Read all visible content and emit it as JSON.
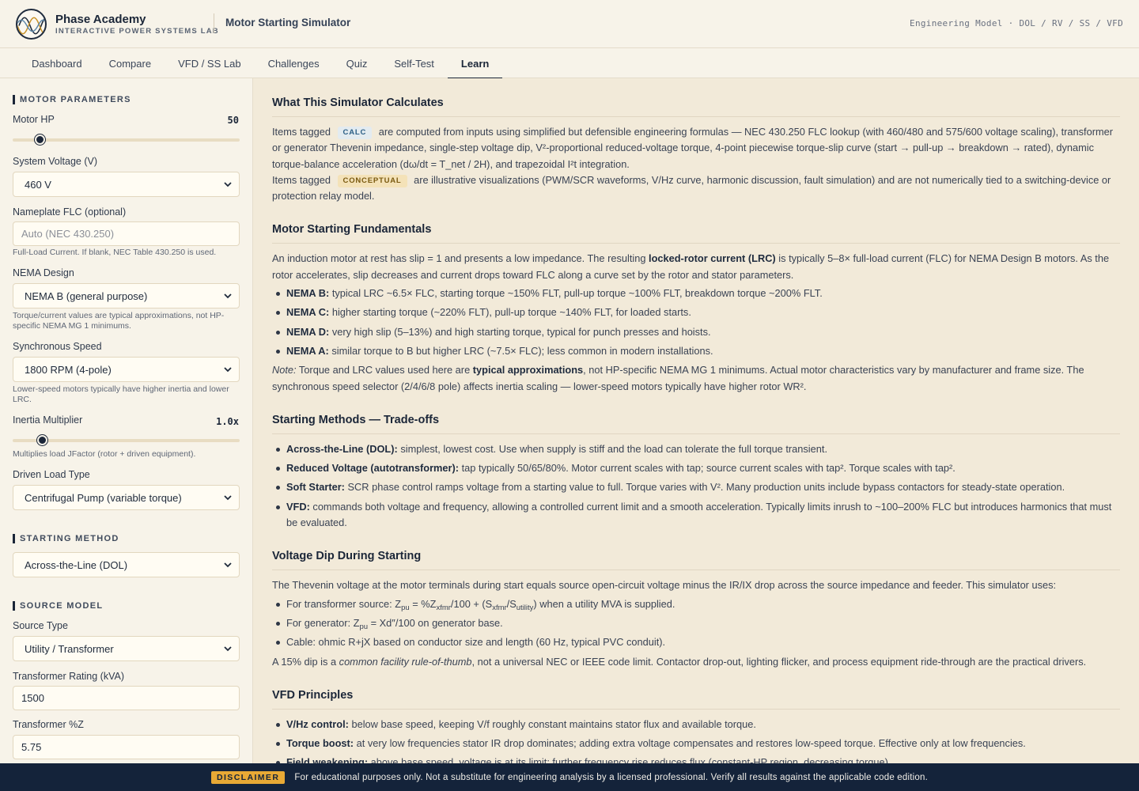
{
  "header": {
    "brand_name": "Phase Academy",
    "brand_sub": "INTERACTIVE POWER SYSTEMS LAB",
    "app_title": "Motor Starting Simulator",
    "meta": "Engineering Model · DOL / RV / SS / VFD"
  },
  "nav": {
    "tabs": [
      {
        "label": "Dashboard"
      },
      {
        "label": "Compare"
      },
      {
        "label": "VFD / SS Lab"
      },
      {
        "label": "Challenges"
      },
      {
        "label": "Quiz"
      },
      {
        "label": "Self-Test"
      },
      {
        "label": "Learn",
        "active": true
      }
    ]
  },
  "sidebar": {
    "motor_params": {
      "heading": "MOTOR PARAMETERS",
      "hp_label": "Motor HP",
      "hp_value": "50",
      "hp_slider_fraction": 0.12,
      "voltage_label": "System Voltage (V)",
      "voltage_value": "460 V",
      "flc_label": "Nameplate FLC (optional)",
      "flc_placeholder": "Auto (NEC 430.250)",
      "flc_hint": "Full-Load Current. If blank, NEC Table 430.250 is used.",
      "nema_label": "NEMA Design",
      "nema_value": "NEMA B (general purpose)",
      "nema_hint": "Torque/current values are typical approximations, not HP-specific NEMA MG 1 minimums.",
      "speed_label": "Synchronous Speed",
      "speed_value": "1800 RPM (4-pole)",
      "speed_hint": "Lower-speed motors typically have higher inertia and lower LRC.",
      "inertia_label": "Inertia Multiplier",
      "inertia_value": "1.0x",
      "inertia_slider_fraction": 0.13,
      "inertia_hint": "Multiplies load JFactor (rotor + driven equipment).",
      "load_label": "Driven Load Type",
      "load_value": "Centrifugal Pump (variable torque)"
    },
    "starting_method": {
      "heading": "STARTING METHOD",
      "value": "Across-the-Line (DOL)"
    },
    "source_model": {
      "heading": "SOURCE MODEL",
      "type_label": "Source Type",
      "type_value": "Utility / Transformer",
      "kva_label": "Transformer Rating (kVA)",
      "kva_value": "1500",
      "z_label": "Transformer %Z",
      "z_value": "5.75"
    }
  },
  "main": {
    "s1": {
      "title": "What This Simulator Calculates",
      "p1_a": "Items tagged",
      "tag_calc": "CALC",
      "p1_b": "are computed from inputs using simplified but defensible engineering formulas — NEC 430.250 FLC lookup (with 460/480 and 575/600 voltage scaling), transformer or generator Thevenin impedance, single-step voltage dip, V²-proportional reduced-voltage torque, 4-point piecewise torque-slip curve (start → pull-up → breakdown → rated), dynamic torque-balance acceleration (dω/dt = T_net / 2H), and trapezoidal I²t integration.",
      "p2_a": "Items tagged",
      "tag_concept": "CONCEPTUAL",
      "p2_b": "are illustrative visualizations (PWM/SCR waveforms, V/Hz curve, harmonic discussion, fault simulation) and are not numerically tied to a switching-device or protection relay model."
    },
    "s2": {
      "title": "Motor Starting Fundamentals",
      "p1_a": "An induction motor at rest has slip = 1 and presents a low impedance. The resulting",
      "p1_b": "locked-rotor current (LRC)",
      "p1_c": "is typically 5–8× full-load current (FLC) for NEMA Design B motors. As the rotor accelerates, slip decreases and current drops toward FLC along a curve set by the rotor and stator parameters.",
      "items": [
        {
          "term": "NEMA B:",
          "text": "typical LRC ~6.5× FLC, starting torque ~150% FLT, pull-up torque ~100% FLT, breakdown torque ~200% FLT."
        },
        {
          "term": "NEMA C:",
          "text": "higher starting torque (~220% FLT), pull-up torque ~140% FLT, for loaded starts."
        },
        {
          "term": "NEMA D:",
          "text": "very high slip (5–13%) and high starting torque, typical for punch presses and hoists."
        },
        {
          "term": "NEMA A:",
          "text": "similar torque to B but higher LRC (~7.5× FLC); less common in modern installations."
        }
      ],
      "note_label": "Note:",
      "note_a": "Torque and LRC values used here are",
      "note_b": "typical approximations",
      "note_c": ", not HP-specific NEMA MG 1 minimums. Actual motor characteristics vary by manufacturer and frame size. The synchronous speed selector (2/4/6/8 pole) affects inertia scaling — lower-speed motors typically have higher rotor WR²."
    },
    "s3": {
      "title": "Starting Methods — Trade-offs",
      "items": [
        {
          "term": "Across-the-Line (DOL):",
          "text": "simplest, lowest cost. Use when supply is stiff and the load can tolerate the full torque transient."
        },
        {
          "term": "Reduced Voltage (autotransformer):",
          "text": "tap typically 50/65/80%. Motor current scales with tap; source current scales with tap². Torque scales with tap²."
        },
        {
          "term": "Soft Starter:",
          "text": "SCR phase control ramps voltage from a starting value to full. Torque varies with V². Many production units include bypass contactors for steady-state operation."
        },
        {
          "term": "VFD:",
          "text": "commands both voltage and frequency, allowing a controlled current limit and a smooth acceleration. Typically limits inrush to ~100–200% FLC but introduces harmonics that must be evaluated."
        }
      ]
    },
    "s4": {
      "title": "Voltage Dip During Starting",
      "p1": "The Thevenin voltage at the motor terminals during start equals source open-circuit voltage minus the IR/IX drop across the source impedance and feeder. This simulator uses:",
      "li1_a": "For transformer source: Z",
      "li1_sub1": "pu",
      "li1_b": " = %Z",
      "li1_sub2": "xfmr",
      "li1_c": "/100 + (S",
      "li1_sub3": "xfmr",
      "li1_d": "/S",
      "li1_sub4": "utility",
      "li1_e": ") when a utility MVA is supplied.",
      "li2_a": "For generator: Z",
      "li2_sub": "pu",
      "li2_b": " = Xd″/100 on generator base.",
      "li3": "Cable: ohmic R+jX based on conductor size and length (60 Hz, typical PVC conduit).",
      "p2_a": "A 15% dip is a",
      "p2_b": "common facility rule-of-thumb",
      "p2_c": ", not a universal NEC or IEEE code limit. Contactor drop-out, lighting flicker, and process equipment ride-through are the practical drivers."
    },
    "s5": {
      "title": "VFD Principles",
      "items": [
        {
          "term": "V/Hz control:",
          "text": "below base speed, keeping V/f roughly constant maintains stator flux and available torque."
        },
        {
          "term": "Torque boost:",
          "text": "at very low frequencies stator IR drop dominates; adding extra voltage compensates and restores low-speed torque. Effective only at low frequencies."
        },
        {
          "term": "Field weakening:",
          "text": "above base speed, voltage is at its limit; further frequency rise reduces flux (constant-HP region, decreasing torque)."
        }
      ]
    }
  },
  "footer": {
    "badge": "DISCLAIMER",
    "text": "For educational purposes only. Not a substitute for engineering analysis by a licensed professional. Verify all results against the applicable code edition."
  }
}
